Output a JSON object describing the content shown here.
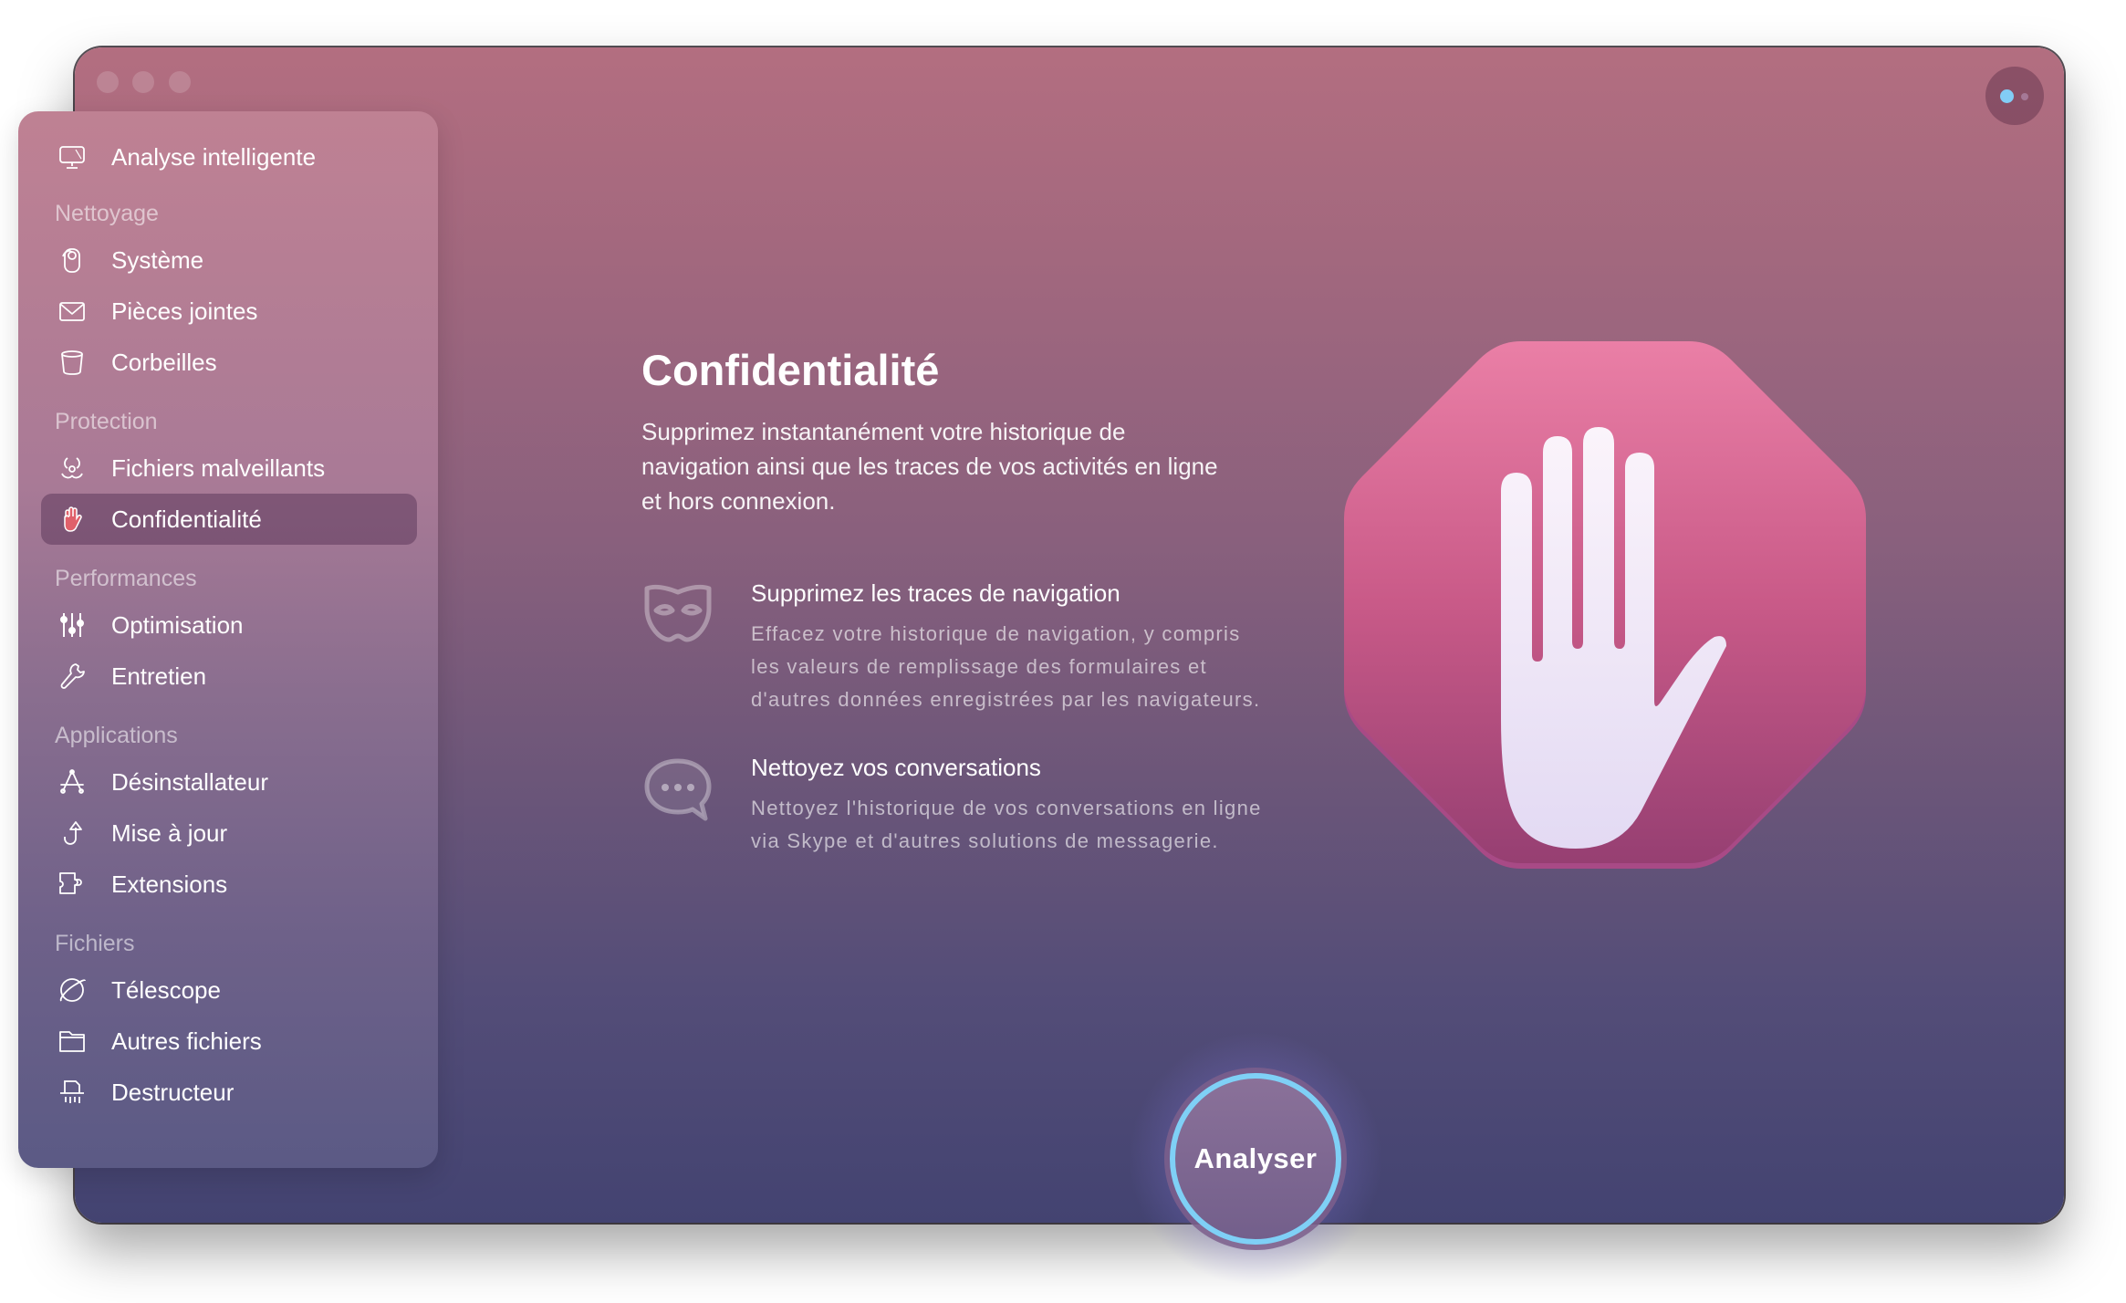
{
  "window": {
    "traffic_lights": [
      "close",
      "minimize",
      "zoom"
    ],
    "assistant_button": {
      "icon": "assistant-dots-icon",
      "accent": "#82cdf6"
    }
  },
  "sidebar": {
    "top_item": {
      "label": "Analyse intelligente",
      "icon": "monitor-icon"
    },
    "sections": [
      {
        "title": "Nettoyage",
        "items": [
          {
            "label": "Système",
            "icon": "system-junk-icon"
          },
          {
            "label": "Pièces jointes",
            "icon": "mail-icon"
          },
          {
            "label": "Corbeilles",
            "icon": "trash-bin-icon"
          }
        ]
      },
      {
        "title": "Protection",
        "items": [
          {
            "label": "Fichiers malveillants",
            "icon": "biohazard-icon"
          },
          {
            "label": "Confidentialité",
            "icon": "hand-icon",
            "selected": true
          }
        ]
      },
      {
        "title": "Performances",
        "items": [
          {
            "label": "Optimisation",
            "icon": "sliders-icon"
          },
          {
            "label": "Entretien",
            "icon": "wrench-icon"
          }
        ]
      },
      {
        "title": "Applications",
        "items": [
          {
            "label": "Désinstallateur",
            "icon": "app-store-icon"
          },
          {
            "label": "Mise à jour",
            "icon": "update-arrow-icon"
          },
          {
            "label": "Extensions",
            "icon": "puzzle-icon"
          }
        ]
      },
      {
        "title": "Fichiers",
        "items": [
          {
            "label": "Télescope",
            "icon": "planet-icon"
          },
          {
            "label": "Autres fichiers",
            "icon": "folder-icon"
          },
          {
            "label": "Destructeur",
            "icon": "shredder-icon"
          }
        ]
      }
    ]
  },
  "main": {
    "title": "Confidentialité",
    "description": "Supprimez instantanément votre historique de navigation ainsi que les traces de vos activités en ligne et hors connexion.",
    "features": [
      {
        "icon": "mask-icon",
        "title": "Supprimez les traces de navigation",
        "description": "Effacez votre historique de navigation, y compris les valeurs de remplissage des formulaires et d'autres données enregistrées par les navigateurs."
      },
      {
        "icon": "chat-bubble-icon",
        "title": "Nettoyez vos conversations",
        "description": "Nettoyez l'historique de vos conversations en ligne via Skype et d'autres solutions de messagerie."
      }
    ],
    "hero_icon": "stop-hand-icon",
    "scan_button": {
      "label": "Analyser",
      "ring_color": "#7fd0f6"
    }
  },
  "colors": {
    "window_top": "#b36e80",
    "window_bottom": "#434371",
    "hero_octagon_top": "#ea7fa6",
    "hero_octagon_bottom": "#963f72",
    "selected_icon": "#e0606a"
  }
}
